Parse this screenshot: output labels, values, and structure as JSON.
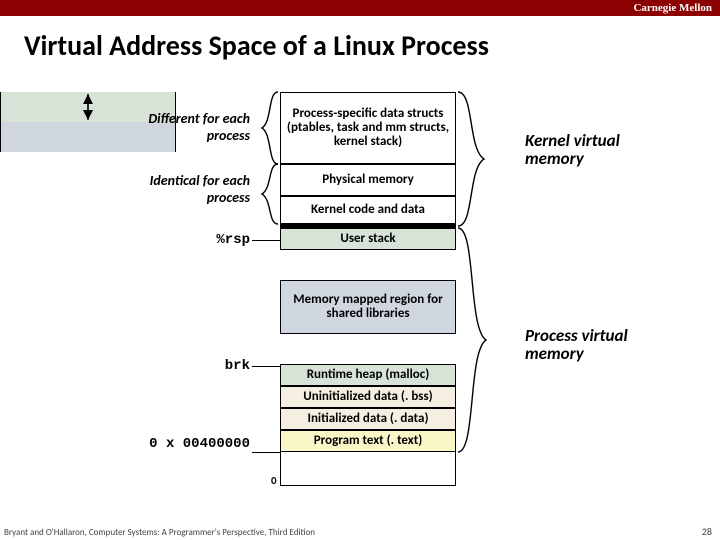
{
  "university": "Carnegie Mellon",
  "title": "Virtual Address Space of a Linux Process",
  "boxes": {
    "psd": "Process-specific data structs  (ptables, task and mm structs, kernel stack)",
    "phys": "Physical memory",
    "kcd": "Kernel code and data",
    "ustk": "User stack",
    "mmap": "Memory mapped region for shared libraries",
    "heap": "Runtime heap (malloc)",
    "bss": "Uninitialized data (. bss)",
    "data": "Initialized data (. data)",
    "text": "Program text (. text)"
  },
  "labels": {
    "diff": "Different for each process",
    "ident": "Identical  for each process",
    "rsp": "%rsp",
    "brk": "brk",
    "addr": "0 x 00400000"
  },
  "rlabels": {
    "kvm": "Kernel virtual memory",
    "pvm": "Process virtual memory"
  },
  "footer": "Bryant and O'Hallaron, Computer Systems: A Programmer's Perspective, Third Edition",
  "page": "28",
  "zero": "0"
}
